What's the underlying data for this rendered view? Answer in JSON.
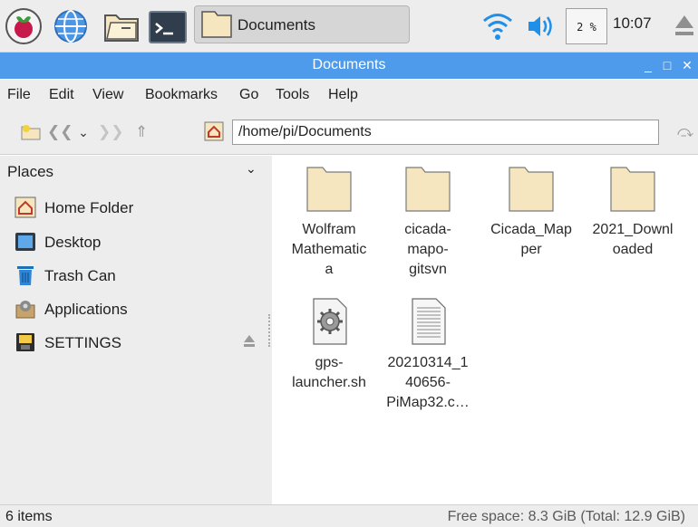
{
  "taskbar": {
    "icons": [
      "raspberry-pi-menu-icon",
      "web-browser-icon",
      "file-manager-icon",
      "terminal-icon"
    ],
    "window_button_label": "Documents",
    "cpu_usage": "2 %",
    "cpu_usage_value": 2,
    "clock": "10:07"
  },
  "window": {
    "title": "Documents"
  },
  "menu": {
    "items": [
      "File",
      "Edit",
      "View",
      "Bookmarks",
      "Go",
      "Tools",
      "Help"
    ]
  },
  "toolbar": {
    "path": "/home/pi/Documents"
  },
  "sidebar": {
    "header": "Places",
    "items": [
      {
        "label": "Home Folder",
        "icon": "home-folder-icon"
      },
      {
        "label": "Desktop",
        "icon": "desktop-icon"
      },
      {
        "label": "Trash Can",
        "icon": "trash-can-icon"
      },
      {
        "label": "Applications",
        "icon": "applications-icon"
      },
      {
        "label": "SETTINGS",
        "icon": "drive-icon"
      }
    ]
  },
  "files": [
    {
      "lines": [
        "Wolfram",
        "Mathematic",
        "a"
      ],
      "type": "folder"
    },
    {
      "lines": [
        "cicada-",
        "mapo-",
        "gitsvn"
      ],
      "type": "folder"
    },
    {
      "lines": [
        "Cicada_Map",
        "per"
      ],
      "type": "folder"
    },
    {
      "lines": [
        "2021_Downl",
        "oaded"
      ],
      "type": "folder"
    },
    {
      "lines": [
        "gps-",
        "launcher.sh"
      ],
      "type": "script"
    },
    {
      "lines": [
        "20210314_1",
        "40656-",
        "PiMap32.c…"
      ],
      "type": "text"
    }
  ],
  "status": {
    "item_count": "6 items",
    "free_space": "Free space: 8.3 GiB (Total: 12.9 GiB)"
  },
  "colors": {
    "titlebar": "#4d9bea",
    "folder": "#f6e6bf",
    "accent_wifi": "#1f8fe8"
  }
}
